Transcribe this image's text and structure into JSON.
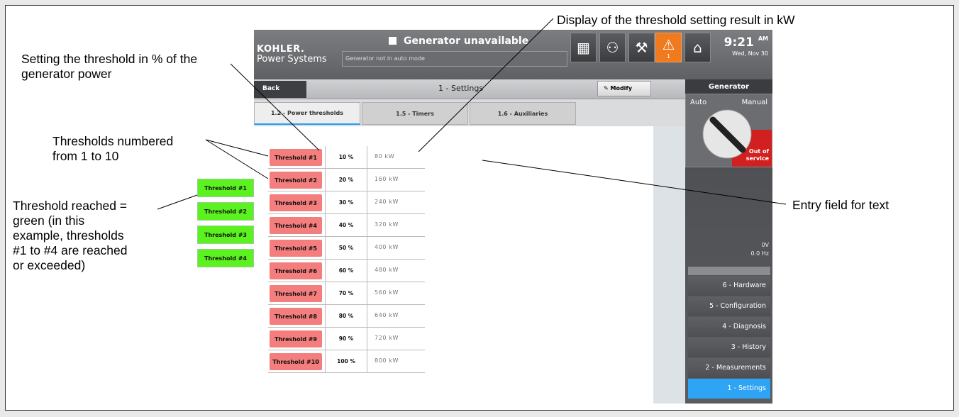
{
  "screen": {
    "brand_line1": "KOHLER.",
    "brand_line2": "Power Systems",
    "generator_status": "Generator unavailable",
    "message": "Generator not in auto mode",
    "alarm_count": "1",
    "time": "9:21",
    "ampm": "AM",
    "date": "Wed, Nov 30",
    "back_label": "Back",
    "page_title": "1 - Settings",
    "modify_label": "Modify",
    "tabs": [
      {
        "label": "1.2 - Power thresholds",
        "active": true
      },
      {
        "label": "1.5 - Timers",
        "active": false
      },
      {
        "label": "1.6 - Auxiliaries",
        "active": false
      }
    ],
    "thresholds": [
      {
        "label": "Threshold #1",
        "percent": "10 %",
        "kw": "80  kW"
      },
      {
        "label": "Threshold #2",
        "percent": "20 %",
        "kw": "160  kW"
      },
      {
        "label": "Threshold #3",
        "percent": "30 %",
        "kw": "240  kW"
      },
      {
        "label": "Threshold #4",
        "percent": "40 %",
        "kw": "320  kW"
      },
      {
        "label": "Threshold #5",
        "percent": "50 %",
        "kw": "400  kW"
      },
      {
        "label": "Threshold #6",
        "percent": "60 %",
        "kw": "480  kW"
      },
      {
        "label": "Threshold #7",
        "percent": "70 %",
        "kw": "560  kW"
      },
      {
        "label": "Threshold #8",
        "percent": "80 %",
        "kw": "640  kW"
      },
      {
        "label": "Threshold #9",
        "percent": "90 %",
        "kw": "720  kW"
      },
      {
        "label": "Threshold #10",
        "percent": "100 %",
        "kw": "800  kW"
      }
    ],
    "right_panel": {
      "title": "Generator",
      "auto_label": "Auto",
      "manual_label": "Manual",
      "out_of_service_line1": "Out of",
      "out_of_service_line2": "service",
      "voltage": "0V",
      "frequency": "0.0 Hz",
      "menu": [
        {
          "label": "6 - Hardware",
          "active": false
        },
        {
          "label": "5 - Configuration",
          "active": false
        },
        {
          "label": "4 - Diagnosis",
          "active": false
        },
        {
          "label": "3 - History",
          "active": false
        },
        {
          "label": "2 - Measurements",
          "active": false
        },
        {
          "label": "1 - Settings",
          "active": true
        }
      ]
    }
  },
  "reached_thresholds": [
    "Threshold #1",
    "Threshold #2",
    "Threshold #3",
    "Threshold #4"
  ],
  "annotations": {
    "setting_line1": "Setting the threshold in % of the",
    "setting_line2": "generator power",
    "numbered_line1": "Thresholds numbered",
    "numbered_line2": "from 1 to 10",
    "reached_line1": "Threshold reached =",
    "reached_line2": "green (in this",
    "reached_line3": "example, thresholds",
    "reached_line4": "#1 to #4 are reached",
    "reached_line5": "or exceeded)",
    "display_kw": "Display of the threshold setting result in kW",
    "entry_field": "Entry field for text"
  },
  "colors": {
    "threshold_not_reached": "#f47d7d",
    "threshold_reached": "#5cf21f",
    "alarm": "#f07a1e",
    "active_menu": "#2ea4f4",
    "out_of_service": "#d21f1f"
  }
}
